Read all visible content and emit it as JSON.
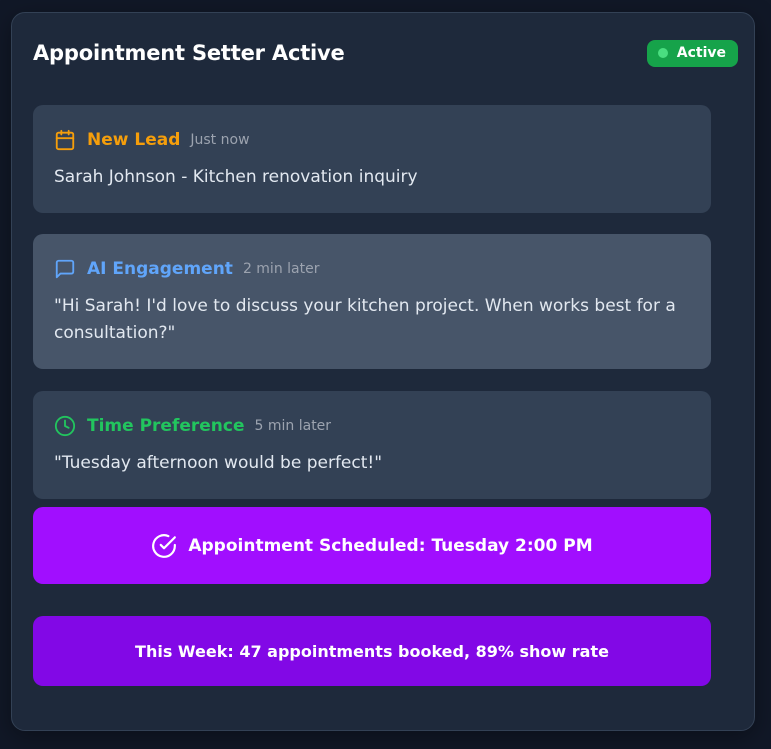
{
  "header": {
    "title": "Appointment Setter Active",
    "status": "Active"
  },
  "colors": {
    "panel": "#1e293b",
    "card": "#334155",
    "card_highlight": "#475569",
    "new_lead": "#f59e0b",
    "ai_engagement": "#60a5fa",
    "time_preference": "#22c55e",
    "scheduled_bg": "#a10eff",
    "stats_bg": "#8208e6",
    "status_badge": "#16a34a"
  },
  "events": [
    {
      "icon": "calendar-icon",
      "title": "New Lead",
      "time": "Just now",
      "message": "Sarah Johnson - Kitchen renovation inquiry"
    },
    {
      "icon": "message-icon",
      "title": "AI Engagement",
      "time": "2 min later",
      "message": "\"Hi Sarah! I'd love to discuss your kitchen project. When works best for a consultation?\""
    },
    {
      "icon": "clock-icon",
      "title": "Time Preference",
      "time": "5 min later",
      "message": "\"Tuesday afternoon would be perfect!\""
    }
  ],
  "scheduled": {
    "icon": "check-circle-icon",
    "label": "Appointment Scheduled: Tuesday 2:00 PM"
  },
  "stats": {
    "label": "This Week: 47 appointments booked, 89% show rate"
  }
}
